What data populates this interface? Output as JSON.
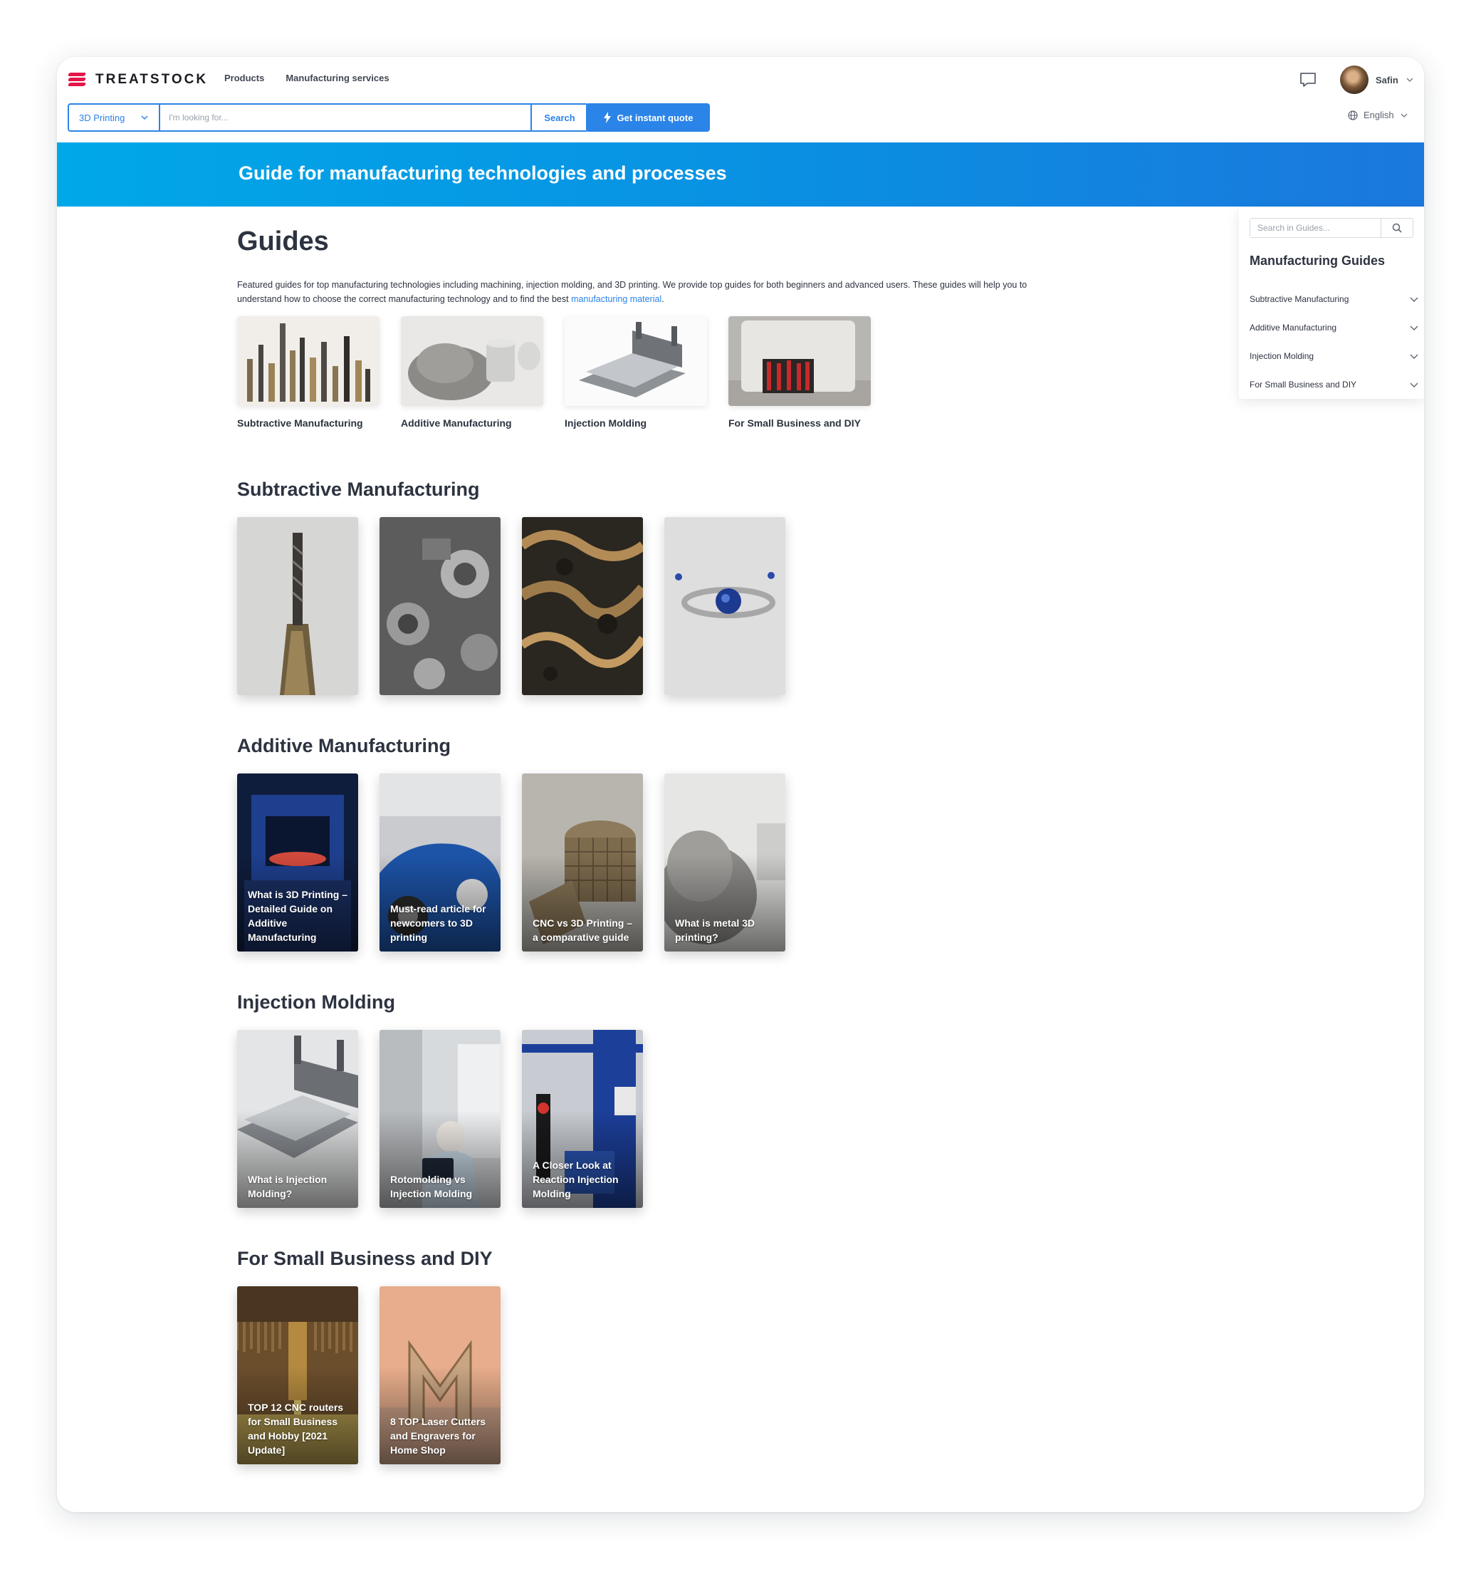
{
  "brand": {
    "name": "TREATSTOCK"
  },
  "nav": {
    "products": "Products",
    "services": "Manufacturing services"
  },
  "user": {
    "name": "Safin"
  },
  "search": {
    "category": "3D Printing",
    "placeholder": "I'm looking for...",
    "button": "Search"
  },
  "quote_button": "Get instant quote",
  "language": "English",
  "banner_title": "Guide for manufacturing technologies and processes",
  "page_title": "Guides",
  "intro": {
    "text": "Featured guides for top manufacturing technologies including machining, injection molding, and 3D printing. We provide top guides for both beginners and advanced users. These guides will help you to understand how to choose the correct manufacturing technology and to find the best ",
    "link": "manufacturing material",
    "end": "."
  },
  "featured": [
    {
      "label": "Subtractive Manufacturing"
    },
    {
      "label": "Additive Manufacturing"
    },
    {
      "label": "Injection Molding"
    },
    {
      "label": "For Small Business and DIY"
    }
  ],
  "sidebar": {
    "search_placeholder": "Search in Guides...",
    "title": "Manufacturing Guides",
    "items": [
      {
        "label": "Subtractive Manufacturing"
      },
      {
        "label": "Additive Manufacturing"
      },
      {
        "label": "Injection Molding"
      },
      {
        "label": "For Small Business and DIY"
      }
    ]
  },
  "sections": [
    {
      "title": "Subtractive Manufacturing",
      "cards": [
        {
          "title": ""
        },
        {
          "title": ""
        },
        {
          "title": ""
        },
        {
          "title": ""
        }
      ]
    },
    {
      "title": "Additive Manufacturing",
      "cards": [
        {
          "title": "What is 3D Printing – Detailed Guide on Additive Manufacturing"
        },
        {
          "title": "Must-read article for newcomers to 3D printing"
        },
        {
          "title": "CNC vs 3D Printing – a comparative guide"
        },
        {
          "title": "What is metal 3D printing?"
        }
      ]
    },
    {
      "title": "Injection Molding",
      "cards": [
        {
          "title": "What is Injection Molding?"
        },
        {
          "title": "Rotomolding vs Injection Molding"
        },
        {
          "title": "A Closer Look at Reaction Injection Molding"
        }
      ]
    },
    {
      "title": "For Small Business and DIY",
      "cards": [
        {
          "title": "TOP 12 CNC routers for Small Business and Hobby [2021 Update]"
        },
        {
          "title": "8 TOP Laser Cutters and Engravers for Home Shop"
        }
      ]
    }
  ],
  "colors": {
    "accent": "#2b84e8",
    "brand": "#e3154a",
    "banner_start": "#00a8e8",
    "banner_end": "#1b78dd"
  }
}
